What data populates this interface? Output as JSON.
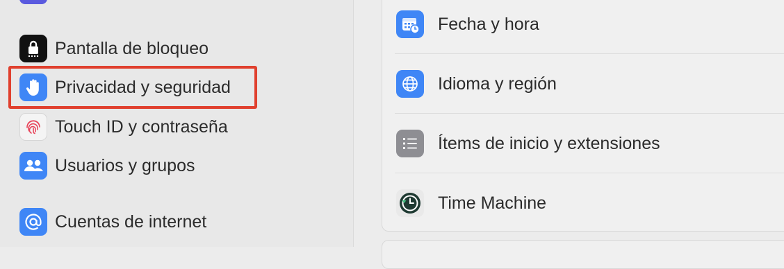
{
  "sidebar": {
    "items": [
      {
        "label": "Pantalla de bloqueo",
        "icon": "lock-icon"
      },
      {
        "label": "Privacidad y seguridad",
        "icon": "hand-icon"
      },
      {
        "label": "Touch ID y contraseña",
        "icon": "fingerprint-icon"
      },
      {
        "label": "Usuarios y grupos",
        "icon": "users-icon"
      },
      {
        "label": "Cuentas de internet",
        "icon": "at-icon"
      }
    ]
  },
  "main": {
    "rows": [
      {
        "label": "Fecha y hora",
        "icon": "calendar-clock-icon"
      },
      {
        "label": "Idioma y región",
        "icon": "globe-icon"
      },
      {
        "label": "Ítems de inicio y extensiones",
        "icon": "list-icon"
      },
      {
        "label": "Time Machine",
        "icon": "time-machine-icon"
      }
    ]
  },
  "colors": {
    "highlight": "#e0402e",
    "accent_blue": "#3b82f6"
  }
}
